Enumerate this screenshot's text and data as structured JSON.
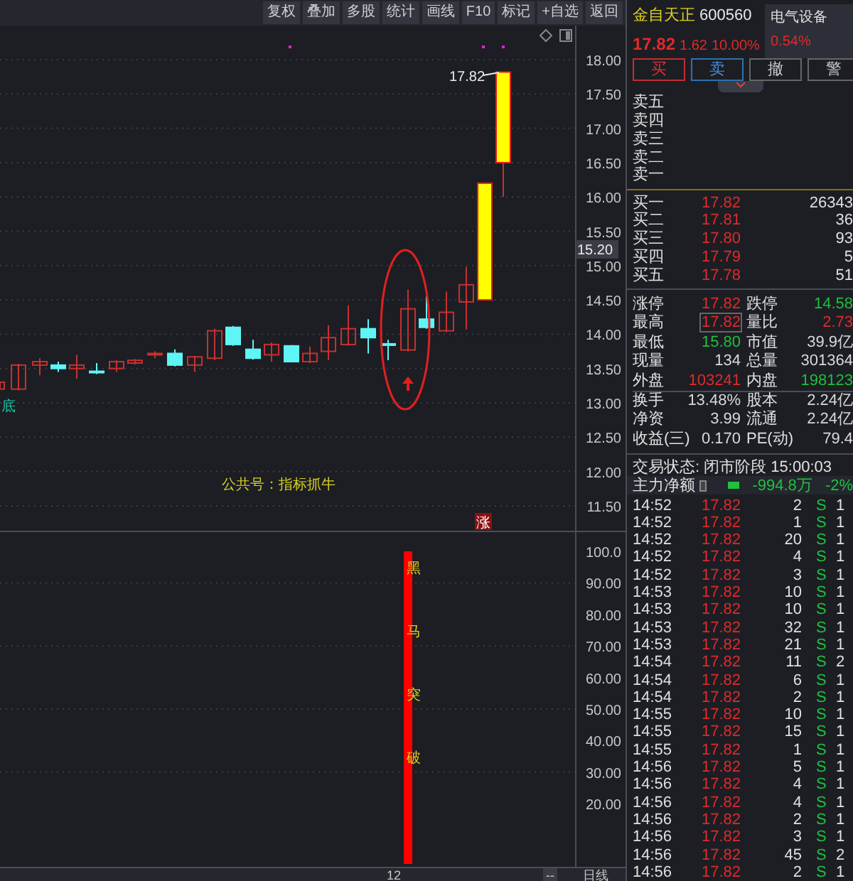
{
  "toolbar": {
    "buttons": [
      "复权",
      "叠加",
      "多股",
      "统计",
      "画线",
      "F10",
      "标记",
      "+自选",
      "返回"
    ]
  },
  "price_chart": {
    "price_labels": [
      "18.00",
      "17.50",
      "17.00",
      "16.50",
      "16.00",
      "15.50",
      "15.00",
      "14.50",
      "14.00",
      "13.50",
      "13.00",
      "12.50",
      "12.00",
      "11.50"
    ],
    "current_price_tag": "15.20",
    "high_label": "17.82",
    "signal_label": "底",
    "chart_note": "公共号：指标抓牛",
    "limit_up_tag": "涨"
  },
  "indicator": {
    "signal_chars": [
      "黑",
      "马",
      "突",
      "破"
    ],
    "axis_labels": [
      "100.0",
      "90.00",
      "80.00",
      "70.00",
      "60.00",
      "50.00",
      "40.00",
      "30.00",
      "20.00"
    ]
  },
  "bottom_bar": {
    "index": "12",
    "scroll_mark": "--",
    "period": "日线"
  },
  "quote": {
    "name": "金自天正",
    "code": "600560",
    "price": "17.82",
    "change": "1.62",
    "change_pct": "10.00%",
    "sector": {
      "name": "电气设备",
      "change": "0.54%"
    },
    "actions": [
      "买",
      "卖",
      "撤",
      "警"
    ],
    "sell": [
      {
        "label": "卖五"
      },
      {
        "label": "卖四"
      },
      {
        "label": "卖三"
      },
      {
        "label": "卖二"
      },
      {
        "label": "卖一"
      }
    ],
    "buy": [
      {
        "label": "买一",
        "price": "17.82",
        "volume": "26343"
      },
      {
        "label": "买二",
        "price": "17.81",
        "volume": "36"
      },
      {
        "label": "买三",
        "price": "17.80",
        "volume": "93"
      },
      {
        "label": "买四",
        "price": "17.79",
        "volume": "5"
      },
      {
        "label": "买五",
        "price": "17.78",
        "volume": "51"
      }
    ],
    "stats": [
      [
        {
          "label": "涨停",
          "value": "17.82",
          "color": "#e02a2a"
        },
        {
          "label": "跌停",
          "value": "14.58",
          "color": "#1fbf3a"
        }
      ],
      [
        {
          "label": "最高",
          "value": "17.82",
          "color": "#e02a2a",
          "selected": true
        },
        {
          "label": "量比",
          "value": "2.73",
          "color": "#e02a2a"
        }
      ],
      [
        {
          "label": "最低",
          "value": "15.80",
          "color": "#1fbf3a"
        },
        {
          "label": "市值",
          "value": "39.9亿",
          "color": "#d8d8d8"
        }
      ],
      [
        {
          "label": "现量",
          "value": "134",
          "color": "#d8d8d8"
        },
        {
          "label": "总量",
          "value": "301364",
          "color": "#d8d8d8"
        }
      ],
      [
        {
          "label": "外盘",
          "value": "103241",
          "color": "#e02a2a"
        },
        {
          "label": "内盘",
          "value": "198123",
          "color": "#1fbf3a"
        }
      ],
      [
        {
          "label": "换手",
          "value": "13.48%",
          "color": "#d8d8d8"
        },
        {
          "label": "股本",
          "value": "2.24亿",
          "color": "#d8d8d8"
        }
      ],
      [
        {
          "label": "净资",
          "value": "3.99",
          "color": "#d8d8d8"
        },
        {
          "label": "流通",
          "value": "2.24亿",
          "color": "#d8d8d8"
        }
      ],
      [
        {
          "label": "收益(三)",
          "value": "0.170",
          "color": "#d8d8d8"
        },
        {
          "label": "PE(动)",
          "value": "79.4",
          "color": "#d8d8d8"
        }
      ]
    ],
    "trade_status": "交易状态: 闭市阶段 15:00:03",
    "main_flow": {
      "label": "主力净额",
      "checked": false,
      "value": "-994.8万",
      "pct": "-2%"
    },
    "trades": [
      {
        "time": "14:52",
        "price": "17.82",
        "volume": "2",
        "side": "S",
        "column_5": "1"
      },
      {
        "time": "14:52",
        "price": "17.82",
        "volume": "1",
        "side": "S",
        "column_5": "1"
      },
      {
        "time": "14:52",
        "price": "17.82",
        "volume": "20",
        "side": "S",
        "column_5": "1"
      },
      {
        "time": "14:52",
        "price": "17.82",
        "volume": "4",
        "side": "S",
        "column_5": "1"
      },
      {
        "time": "14:52",
        "price": "17.82",
        "volume": "3",
        "side": "S",
        "column_5": "1"
      },
      {
        "time": "14:53",
        "price": "17.82",
        "volume": "10",
        "side": "S",
        "column_5": "1"
      },
      {
        "time": "14:53",
        "price": "17.82",
        "volume": "10",
        "side": "S",
        "column_5": "1"
      },
      {
        "time": "14:53",
        "price": "17.82",
        "volume": "32",
        "side": "S",
        "column_5": "1"
      },
      {
        "time": "14:53",
        "price": "17.82",
        "volume": "21",
        "side": "S",
        "column_5": "1"
      },
      {
        "time": "14:54",
        "price": "17.82",
        "volume": "11",
        "side": "S",
        "column_5": "2"
      },
      {
        "time": "14:54",
        "price": "17.82",
        "volume": "6",
        "side": "S",
        "column_5": "1"
      },
      {
        "time": "14:54",
        "price": "17.82",
        "volume": "2",
        "side": "S",
        "column_5": "1"
      },
      {
        "time": "14:55",
        "price": "17.82",
        "volume": "10",
        "side": "S",
        "column_5": "1"
      },
      {
        "time": "14:55",
        "price": "17.82",
        "volume": "15",
        "side": "S",
        "column_5": "1"
      },
      {
        "time": "14:55",
        "price": "17.82",
        "volume": "1",
        "side": "S",
        "column_5": "1"
      },
      {
        "time": "14:56",
        "price": "17.82",
        "volume": "5",
        "side": "S",
        "column_5": "1"
      },
      {
        "time": "14:56",
        "price": "17.82",
        "volume": "4",
        "side": "S",
        "column_5": "1"
      },
      {
        "time": "14:56",
        "price": "17.82",
        "volume": "4",
        "side": "S",
        "column_5": "1"
      },
      {
        "time": "14:56",
        "price": "17.82",
        "volume": "2",
        "side": "S",
        "column_5": "1"
      },
      {
        "time": "14:56",
        "price": "17.82",
        "volume": "3",
        "side": "S",
        "column_5": "1"
      },
      {
        "time": "14:56",
        "price": "17.82",
        "volume": "45",
        "side": "S",
        "column_5": "2"
      },
      {
        "time": "14:56",
        "price": "17.82",
        "volume": "2",
        "side": "S",
        "column_5": "1"
      }
    ]
  }
}
